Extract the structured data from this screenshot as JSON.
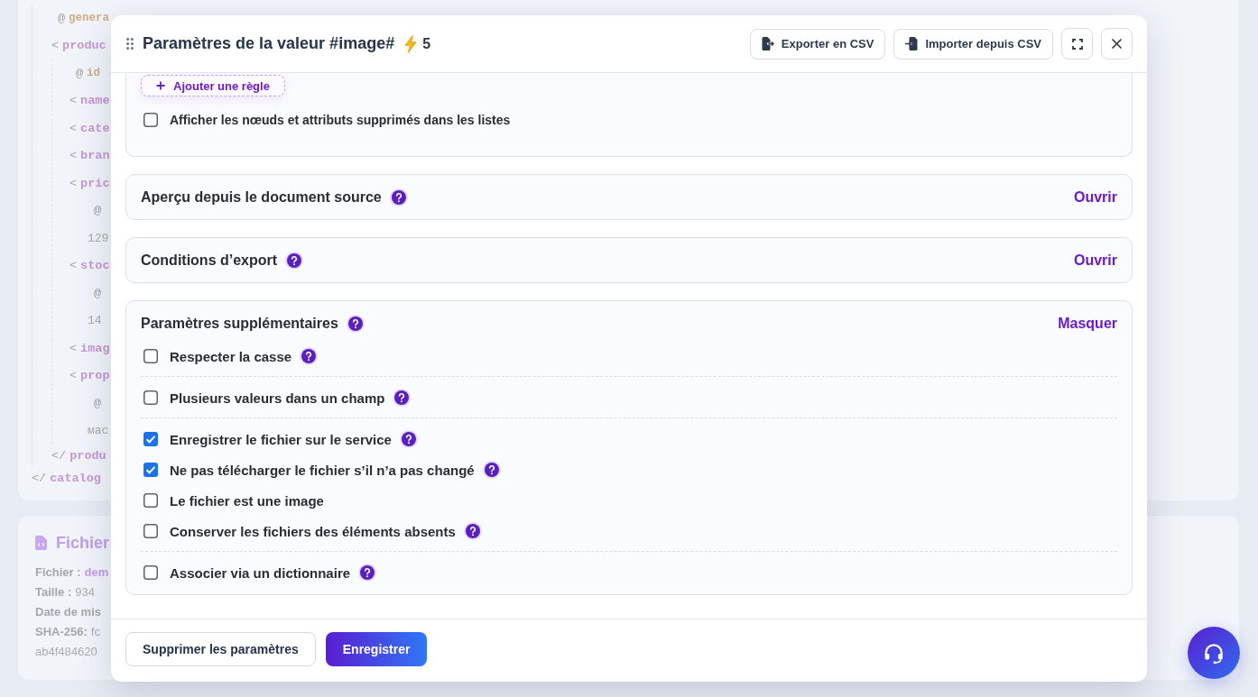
{
  "background": {
    "xml_tree": {
      "children": [
        {
          "kind": "attribute",
          "marker": "@",
          "name": "genera"
        },
        {
          "kind": "element",
          "marker": "<",
          "name": "produc",
          "children": [
            {
              "kind": "attribute",
              "marker": "@",
              "name": "id"
            },
            {
              "kind": "element",
              "marker": "<",
              "name": "name"
            },
            {
              "kind": "element",
              "marker": "<",
              "name": "cate"
            },
            {
              "kind": "element",
              "marker": "<",
              "name": "bran"
            },
            {
              "kind": "element",
              "marker": "<",
              "name": "pric",
              "children": [
                {
                  "kind": "attribute",
                  "marker": "@"
                },
                {
                  "kind": "value",
                  "name": "129"
                }
              ]
            },
            {
              "kind": "element",
              "marker": "<",
              "name": "stoc",
              "children": [
                {
                  "kind": "attribute",
                  "marker": "@"
                },
                {
                  "kind": "value",
                  "name": "14"
                }
              ]
            },
            {
              "kind": "element",
              "marker": "<",
              "name": "imag"
            },
            {
              "kind": "element",
              "marker": "<",
              "name": "prop",
              "children": [
                {
                  "kind": "attribute",
                  "marker": "@"
                },
                {
                  "kind": "value",
                  "name": "мас"
                }
              ]
            }
          ],
          "close": {
            "marker": "</",
            "name": "produ"
          }
        }
      ],
      "close": {
        "marker": "</",
        "name": "catalog"
      }
    },
    "file_card": {
      "title": "Fichier",
      "rows": [
        {
          "label": "Fichier :",
          "value": "dem",
          "kind": "link"
        },
        {
          "label": "Taille :",
          "value": "934",
          "kind": "plain"
        },
        {
          "label": "Date de mis"
        },
        {
          "label": "SHA-256:",
          "value": "fc",
          "kind": "plain"
        },
        {
          "value": "ab4f484620",
          "kind": "plain"
        }
      ]
    }
  },
  "modal": {
    "title": "Paramètres de la valeur #image#",
    "count": "5",
    "header_buttons": [
      {
        "kind": "export",
        "label": "Exporter en CSV"
      },
      {
        "kind": "import",
        "label": "Importer depuis CSV"
      },
      {
        "kind": "expand"
      },
      {
        "kind": "close"
      }
    ],
    "sections": [
      {
        "kind": "rules",
        "add_rule_label": "Ajouter une règle",
        "options": [
          {
            "label": "Afficher les nœuds et attributs supprimés dans les listes",
            "checked": false,
            "help": false
          }
        ]
      },
      {
        "kind": "collapsible",
        "title": "Aperçu depuis le document source",
        "help": true,
        "toggle": "Ouvrir",
        "expanded": false
      },
      {
        "kind": "collapsible",
        "title": "Conditions d’export",
        "help": true,
        "toggle": "Ouvrir",
        "expanded": false
      },
      {
        "kind": "collapsible",
        "title": "Paramètres supplémentaires",
        "help": true,
        "toggle": "Masquer",
        "expanded": true,
        "groups": [
          {
            "options": [
              {
                "label": "Respecter la casse",
                "checked": false,
                "help": true
              }
            ]
          },
          {
            "options": [
              {
                "label": "Plusieurs valeurs dans un champ",
                "checked": false,
                "help": true
              }
            ]
          },
          {
            "options": [
              {
                "label": "Enregistrer le fichier sur le service",
                "checked": true,
                "help": true
              },
              {
                "label": "Ne pas télécharger le fichier s’il n’a pas changé",
                "checked": true,
                "help": true
              },
              {
                "label": "Le fichier est une image",
                "checked": false,
                "help": false
              },
              {
                "label": "Conserver les fichiers des éléments absents",
                "checked": false,
                "help": true
              }
            ]
          },
          {
            "options": [
              {
                "label": "Associer via un dictionnaire",
                "checked": false,
                "help": true
              }
            ]
          }
        ]
      }
    ],
    "footer_buttons": [
      {
        "kind": "reset",
        "label": "Supprimer les paramètres"
      },
      {
        "kind": "save",
        "label": "Enregistrer"
      }
    ]
  }
}
